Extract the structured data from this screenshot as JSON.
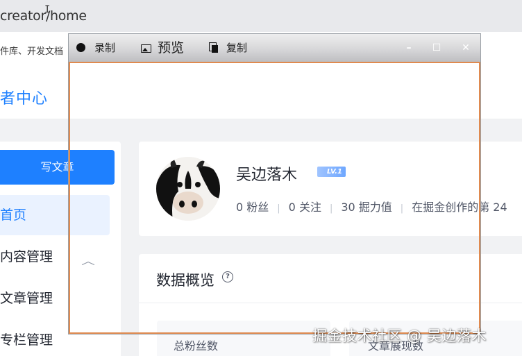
{
  "browser": {
    "url": "creator/home",
    "bookmarks_text": "件库、开发文档"
  },
  "site": {
    "brand": "者中心"
  },
  "sidebar": {
    "write_button": "写文章",
    "items": [
      {
        "label": "首页",
        "active": true
      },
      {
        "label": "内容管理",
        "expanded": true
      },
      {
        "label": "文章管理"
      },
      {
        "label": "专栏管理"
      }
    ],
    "expand_icon": "chevron-up-icon"
  },
  "profile": {
    "name": "吴边落木",
    "level": "LV.1",
    "fans_stat": "0 粉丝",
    "following_stat": "0 关注",
    "power_stat": "30 掘力值",
    "rank_stat": "在掘金创作的第 24",
    "avatar_icon": "cow-avatar"
  },
  "overview": {
    "title": "数据概览",
    "help_icon": "help-circle-icon",
    "stat1_label": "总粉丝数",
    "stat2_label": "文章展现数"
  },
  "recorder": {
    "record_label": "录制",
    "preview_label": "预览",
    "copy_label": "复制",
    "minimize_symbol": "–",
    "maximize_symbol": "☐",
    "close_symbol": "✕",
    "frame_color": "#e08a4f"
  },
  "watermark": "掘金技术社区 @ 吴边落木",
  "colors": {
    "accent": "#1e80ff"
  }
}
